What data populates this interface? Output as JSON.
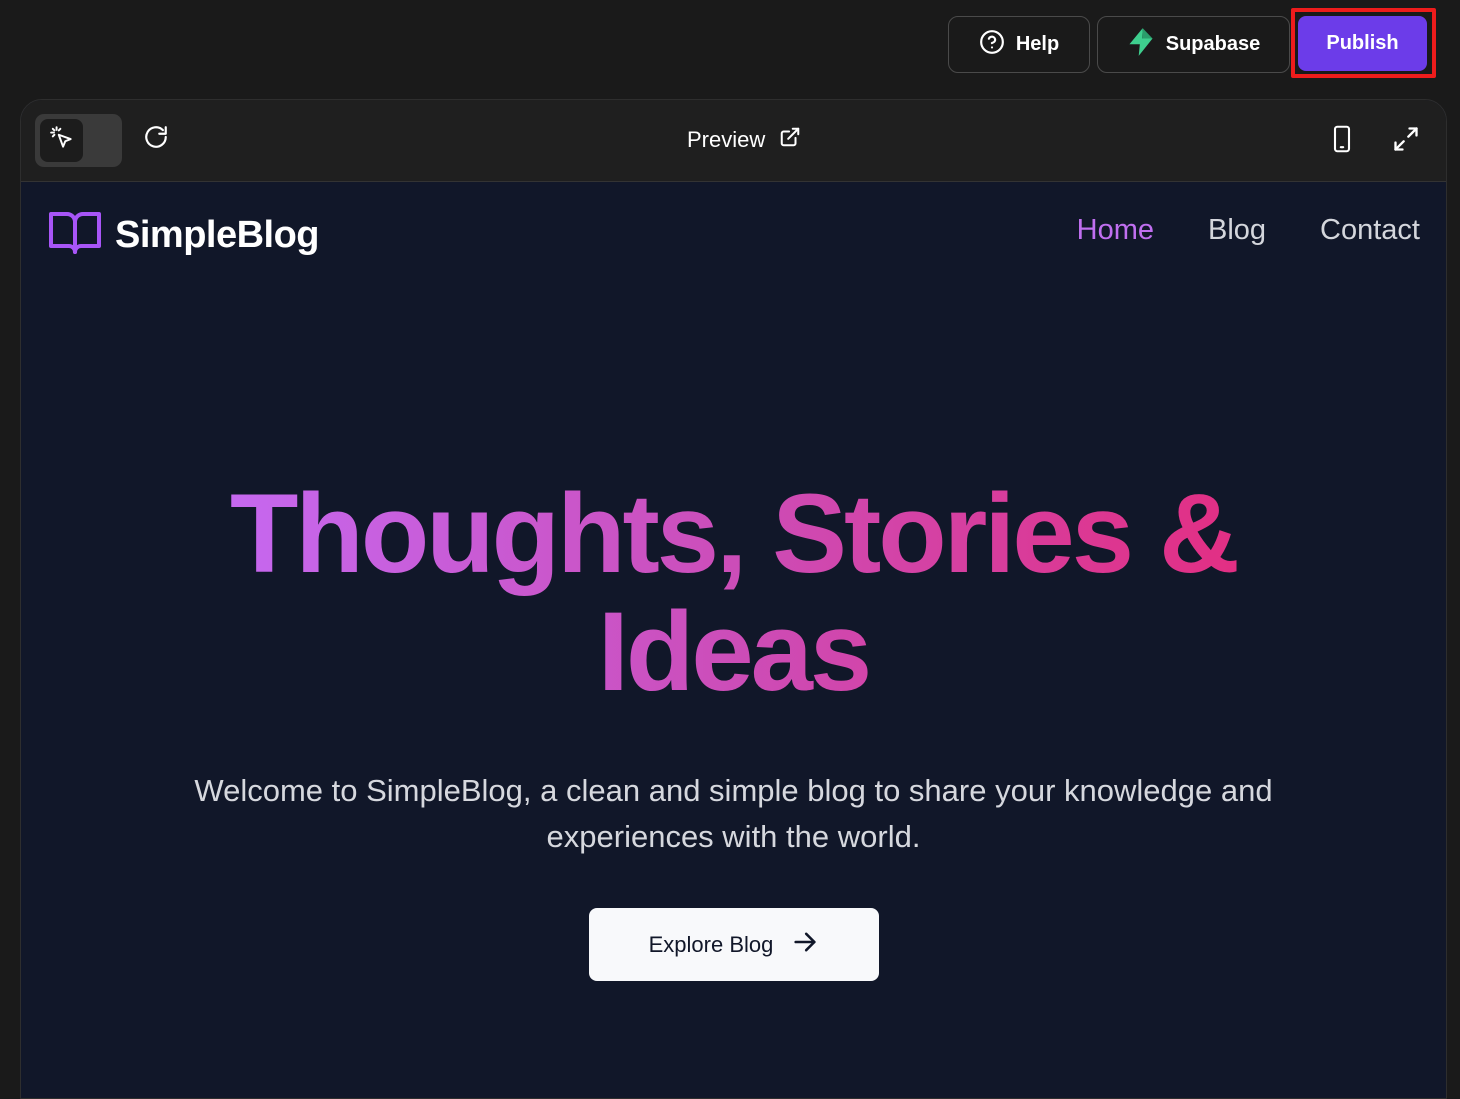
{
  "topbar": {
    "help_label": "Help",
    "supabase_label": "Supabase",
    "publish_label": "Publish"
  },
  "toolbar": {
    "preview_label": "Preview"
  },
  "site": {
    "brand": "SimpleBlog",
    "nav": [
      {
        "label": "Home",
        "active": true
      },
      {
        "label": "Blog",
        "active": false
      },
      {
        "label": "Contact",
        "active": false
      }
    ],
    "hero_title_line1": "Thoughts, Stories &",
    "hero_title_line2": "Ideas",
    "hero_subtitle": "Welcome to SimpleBlog, a clean and simple blog to share your knowledge and experiences with the world.",
    "cta_label": "Explore Blog"
  },
  "colors": {
    "publish": "#6c3ce9",
    "highlight": "#ee1c1c",
    "accent": "#c06ff0",
    "supabase_green": "#3ecf8e",
    "site_bg": "#111729"
  },
  "icons": [
    "help-circle-icon",
    "supabase-bolt-icon",
    "cursor-select-icon",
    "refresh-icon",
    "external-link-icon",
    "mobile-icon",
    "expand-icon",
    "book-open-icon",
    "arrow-right-icon"
  ]
}
